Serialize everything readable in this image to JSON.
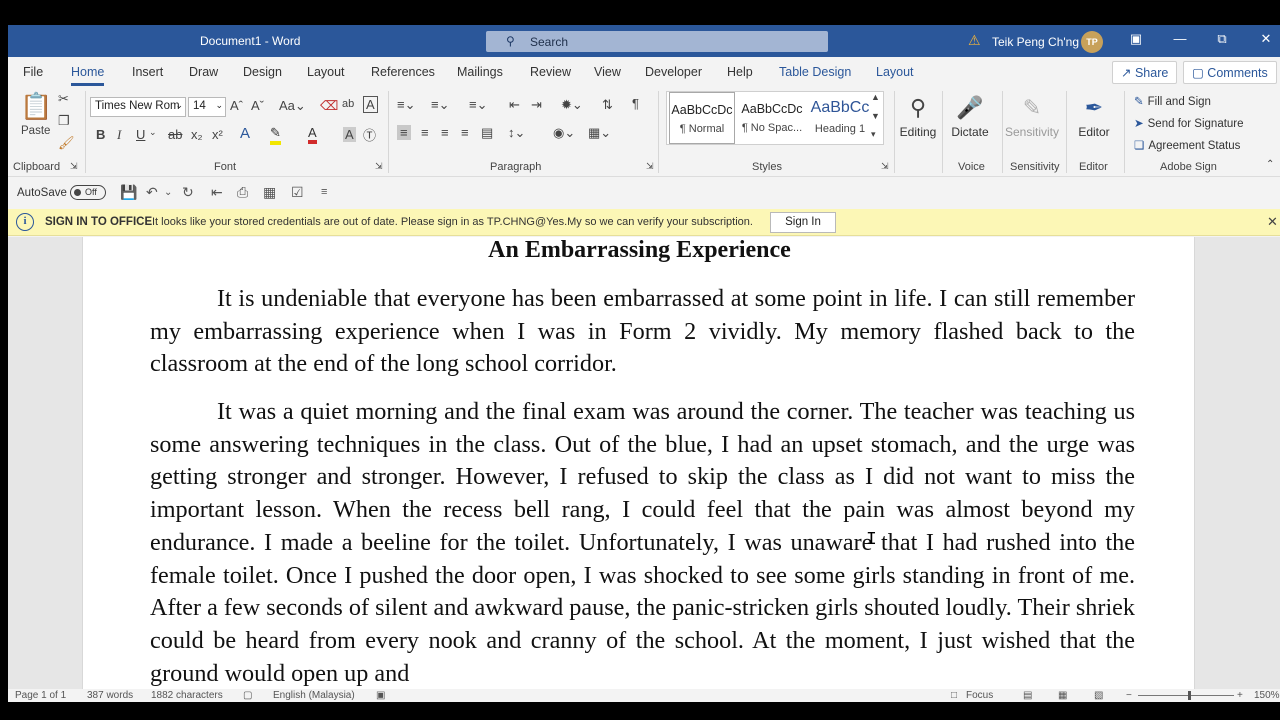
{
  "titlebar": {
    "doc_title": "Document1  -  Word",
    "search_placeholder": "Search",
    "user_name": "Teik Peng Ch'ng",
    "user_initials": "TP"
  },
  "tabs": [
    {
      "label": "File"
    },
    {
      "label": "Home",
      "active": true
    },
    {
      "label": "Insert"
    },
    {
      "label": "Draw"
    },
    {
      "label": "Design"
    },
    {
      "label": "Layout"
    },
    {
      "label": "References"
    },
    {
      "label": "Mailings"
    },
    {
      "label": "Review"
    },
    {
      "label": "View"
    },
    {
      "label": "Developer"
    },
    {
      "label": "Help"
    },
    {
      "label": "Table Design"
    },
    {
      "label": "Layout"
    }
  ],
  "header_buttons": {
    "share": "Share",
    "comments": "Comments"
  },
  "ribbon": {
    "clipboard": {
      "paste_label": "Paste",
      "group_label": "Clipboard"
    },
    "font": {
      "font_name": "Times New Rom",
      "font_size": "14",
      "group_label": "Font"
    },
    "paragraph": {
      "group_label": "Paragraph"
    },
    "styles": {
      "group_label": "Styles",
      "items": [
        {
          "preview": "AaBbCcDc",
          "name": "¶ Normal"
        },
        {
          "preview": "AaBbCcDc",
          "name": "¶ No Spac..."
        },
        {
          "preview": "AaBbCc",
          "name": "Heading 1"
        }
      ]
    },
    "editing": {
      "label": "Editing"
    },
    "voice": {
      "button_label": "Dictate",
      "group_label": "Voice"
    },
    "sensitivity": {
      "button_label": "Sensitivity",
      "group_label": "Sensitivity"
    },
    "editor": {
      "button_label": "Editor",
      "group_label": "Editor"
    },
    "adobe": {
      "group_label": "Adobe Sign",
      "items": [
        "Fill and Sign",
        "Send for Signature",
        "Agreement Status"
      ]
    }
  },
  "qat": {
    "autosave_label": "AutoSave",
    "autosave_state": "Off"
  },
  "notification": {
    "title": "SIGN IN TO OFFICE",
    "message": "It looks like your stored credentials are out of date. Please sign in as TP.CHNG@Yes.My so we can verify your subscription.",
    "button": "Sign In"
  },
  "document": {
    "heading": "An Embarrassing Experience",
    "paragraphs": [
      "It is undeniable that everyone has been embarrassed at some point in life. I can still remember my embarrassing experience when I was in Form 2 vividly. My memory flashed back to the classroom at the end of the long school corridor.",
      "It was a quiet morning and the final exam was around the corner. The teacher was teaching us some answering techniques in the class. Out of the blue, I had an upset stomach, and the urge was getting stronger and stronger. However, I refused to skip the class as I did not want to miss the important lesson. When the recess bell rang, I could feel that the pain was almost beyond my endurance. I made a beeline for the toilet. Unfortunately, I was unaware that I had rushed into the female toilet. Once I pushed the door open, I was shocked to see some girls standing in front of me. After a few seconds of silent and awkward pause, the panic-stricken girls shouted loudly. Their shriek could be heard from every nook and cranny of the school. At the moment, I just wished that the ground would open up and"
    ]
  },
  "statusbar": {
    "page": "Page 1 of 1",
    "words": "387 words",
    "characters": "1882 characters",
    "language": "English (Malaysia)",
    "focus": "Focus",
    "zoom": "150%"
  }
}
